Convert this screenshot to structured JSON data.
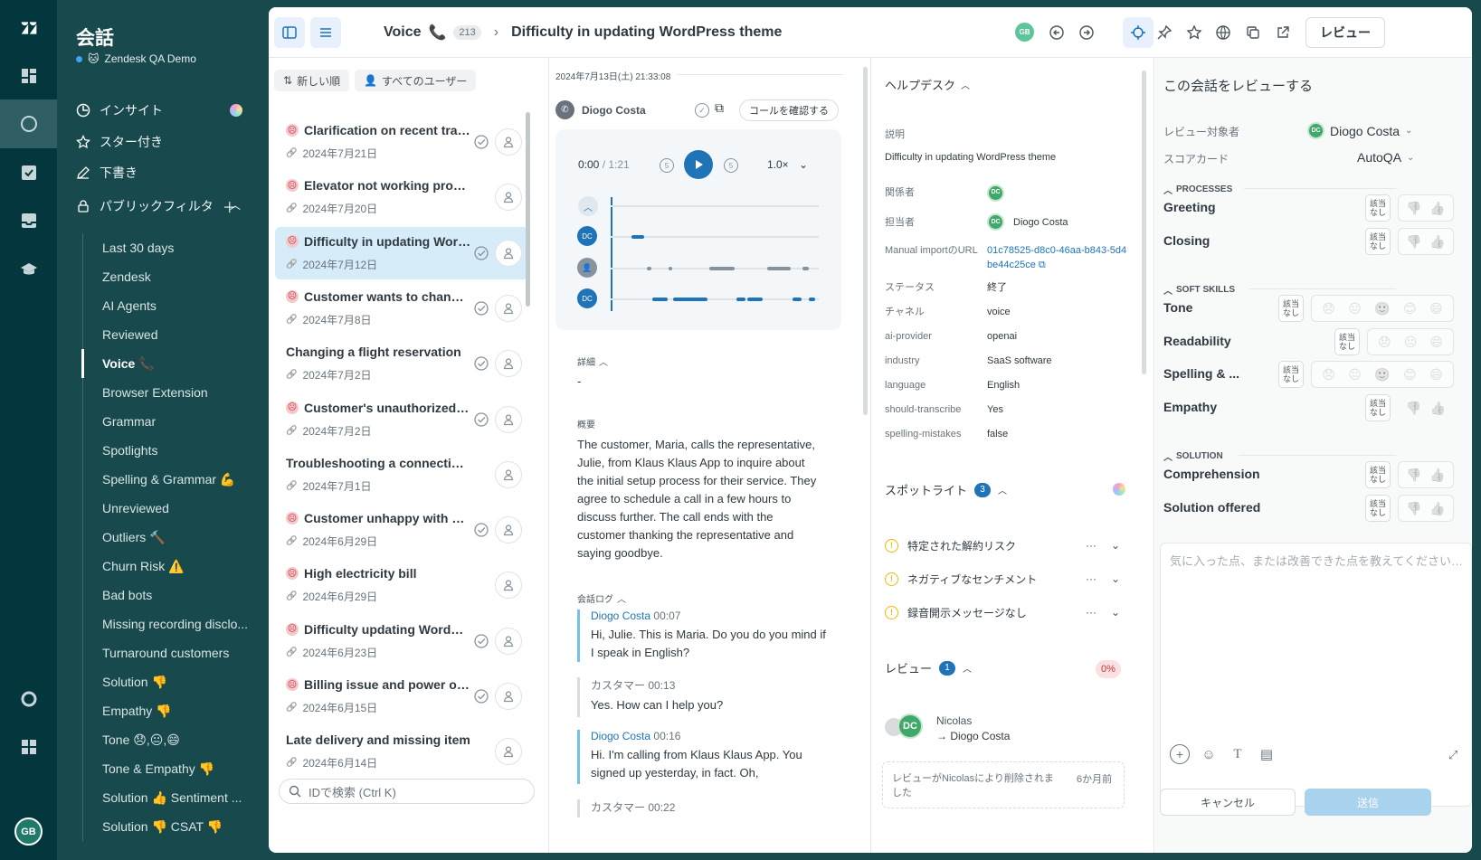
{
  "rail": {
    "items": [
      "zendesk-logo-icon",
      "dashboard-icon",
      "conversations-icon",
      "tasks-icon",
      "inbox-icon",
      "coaching-icon",
      "help-icon",
      "apps-icon"
    ],
    "avatar": "GB"
  },
  "sidebar": {
    "title": "会話",
    "workspace": "Zendesk QA Demo",
    "nav": [
      {
        "label": "インサイト",
        "icon": "insights-icon"
      },
      {
        "label": "スター付き",
        "icon": "star-icon"
      },
      {
        "label": "下書き",
        "icon": "pencil-icon"
      },
      {
        "label": "パブリックフィルタ",
        "icon": "lock-icon"
      }
    ],
    "filters": [
      "Last 30 days",
      "Zendesk",
      "AI Agents",
      "Reviewed",
      "Voice 📞",
      "Browser Extension",
      "Grammar",
      "Spotlights",
      "Spelling & Grammar 💪",
      "Unreviewed",
      "Outliers 🔨",
      "Churn Risk ⚠️",
      "Bad bots",
      "Missing recording disclo...",
      "Turnaround customers",
      "Solution 👎",
      "Empathy 👎",
      "Tone 😞,😐,😄",
      "Tone & Empathy 👎",
      "Solution 👍 Sentiment ...",
      "Solution 👎 CSAT 👎"
    ],
    "active_filter_index": 4
  },
  "topbar": {
    "channel": "Voice",
    "count": "213",
    "title": "Difficulty in updating WordPress theme",
    "badge": "GB",
    "review_button": "レビュー"
  },
  "list": {
    "sort_chip": "新しい順",
    "user_chip": "すべてのユーザー",
    "search_placeholder": "IDで検索 (Ctrl K)",
    "items": [
      {
        "title": "Clarification on recent tran...",
        "date": "2024年7月21日",
        "sad": true,
        "reviewed": true
      },
      {
        "title": "Elevator not working properly",
        "date": "2024年7月20日",
        "sad": true,
        "reviewed": false
      },
      {
        "title": "Difficulty in updating Word...",
        "date": "2024年7月12日",
        "sad": true,
        "reviewed": true
      },
      {
        "title": "Customer wants to change ...",
        "date": "2024年7月8日",
        "sad": true,
        "reviewed": true
      },
      {
        "title": "Changing a flight reservation",
        "date": "2024年7月2日",
        "sad": false,
        "reviewed": true
      },
      {
        "title": "Customer's unauthorized tr...",
        "date": "2024年7月2日",
        "sad": true,
        "reviewed": true
      },
      {
        "title": "Troubleshooting a connection iss...",
        "date": "2024年7月1日",
        "sad": false,
        "reviewed": false
      },
      {
        "title": "Customer unhappy with cla...",
        "date": "2024年6月29日",
        "sad": true,
        "reviewed": true
      },
      {
        "title": "High electricity bill",
        "date": "2024年6月29日",
        "sad": true,
        "reviewed": false
      },
      {
        "title": "Difficulty updating WordPr...",
        "date": "2024年6月23日",
        "sad": true,
        "reviewed": true
      },
      {
        "title": "Billing issue and power out...",
        "date": "2024年6月15日",
        "sad": true,
        "reviewed": true
      },
      {
        "title": "Late delivery and missing item",
        "date": "2024年6月14日",
        "sad": false,
        "reviewed": false
      }
    ],
    "selected_index": 2
  },
  "transcript": {
    "datetime": "2024年7月13日(土) 21:33:08",
    "agent": "Diogo Costa",
    "confirm_call": "コールを確認する",
    "player": {
      "current": "0:00",
      "total": "/ 1:21",
      "speed": "1.0×"
    },
    "details_label": "詳細",
    "details_value": "-",
    "summary_label": "概要",
    "summary": "The customer, Maria, calls the representative, Julie, from Klaus Klaus App to inquire about the initial setup process for their service. They agree to schedule a call in a few hours to discuss further. The call ends with the customer thanking the representative and saying goodbye.",
    "log_label": "会話ログ",
    "messages": [
      {
        "who": "Diogo Costa",
        "time": "00:07",
        "text": "Hi, Julie. This is Maria. Do you do you mind if I speak in English?",
        "agent": true
      },
      {
        "who": "カスタマー",
        "time": "00:13",
        "text": "Yes. How can I help you?",
        "agent": false
      },
      {
        "who": "Diogo Costa",
        "time": "00:16",
        "text": "Hi. I'm calling from Klaus Klaus App. You signed up yesterday, in fact. Oh,",
        "agent": true
      },
      {
        "who": "カスタマー",
        "time": "00:22",
        "text": "",
        "agent": false
      }
    ]
  },
  "helpdesk": {
    "header": "ヘルプデスク",
    "fields": [
      {
        "k": "説明",
        "v": "Difficulty in updating WordPress theme"
      },
      {
        "k": "関係者",
        "v": ""
      },
      {
        "k": "担当者",
        "v": "Diogo Costa"
      },
      {
        "k": "Manual importのURL",
        "v": "01c78525-d8c0-46aa-b843-5d4be44c25ce"
      },
      {
        "k": "ステータス",
        "v": "終了"
      },
      {
        "k": "チャネル",
        "v": "voice"
      },
      {
        "k": "ai-provider",
        "v": "openai"
      },
      {
        "k": "industry",
        "v": "SaaS software"
      },
      {
        "k": "language",
        "v": "English"
      },
      {
        "k": "should-transcribe",
        "v": "Yes"
      },
      {
        "k": "spelling-mistakes",
        "v": "false"
      }
    ],
    "spotlight_label": "スポットライト",
    "spotlight_count": "3",
    "spotlights": [
      "特定された解約リスク",
      "ネガティブなセンチメント",
      "録音開示メッセージなし"
    ],
    "reviews_label": "レビュー",
    "reviews_count": "1",
    "reviews_pct": "0%",
    "reviewer": "Nicolas",
    "reviewee": "→ Diogo Costa",
    "deleted_note": "レビューがNicolasにより削除されました",
    "deleted_time": "6か月前"
  },
  "review": {
    "title": "この会話をレビューする",
    "reviewee_label": "レビュー対象者",
    "reviewee": "Diogo Costa",
    "scorecard_label": "スコアカード",
    "scorecard": "AutoQA",
    "na": "該当なし",
    "sections": [
      {
        "name": "PROCESSES",
        "criteria": [
          {
            "name": "Greeting",
            "type": "thumbs"
          },
          {
            "name": "Closing",
            "type": "thumbs"
          }
        ]
      },
      {
        "name": "SOFT SKILLS",
        "criteria": [
          {
            "name": "Tone",
            "type": "5"
          },
          {
            "name": "Readability",
            "type": "3"
          },
          {
            "name": "Spelling & ...",
            "type": "5"
          },
          {
            "name": "Empathy",
            "type": "thumbs-plain"
          }
        ]
      },
      {
        "name": "SOLUTION",
        "criteria": [
          {
            "name": "Comprehension",
            "type": "thumbs"
          },
          {
            "name": "Solution offered",
            "type": "thumbs"
          }
        ]
      }
    ],
    "comment_placeholder": "気に入った点、または改善できた点を教えてください…",
    "cancel": "キャンセル",
    "send": "送信"
  }
}
